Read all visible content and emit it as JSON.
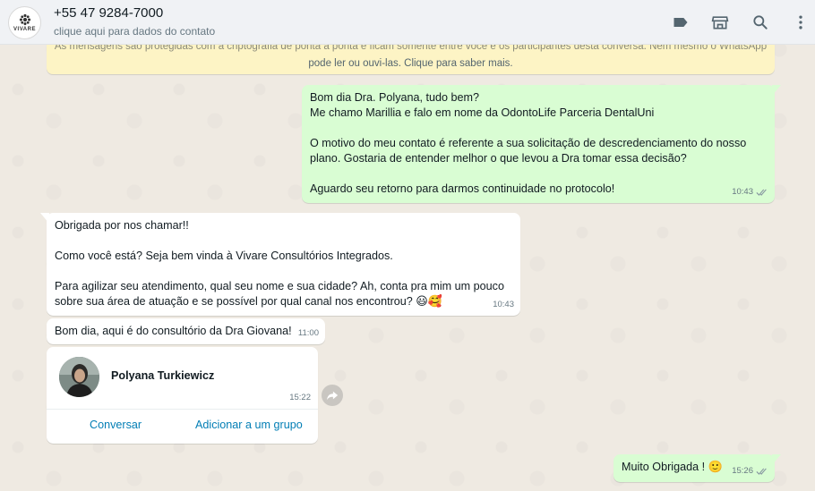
{
  "header": {
    "avatar_text": "VIVARE",
    "contact_name": "+55 47 9284-7000",
    "contact_subtitle": "clique aqui para dados do contato",
    "icons": [
      "label-icon",
      "store-icon",
      "search-icon",
      "menu-icon"
    ]
  },
  "encryption_banner": {
    "line1": "As mensagens são protegidas com a criptografia de ponta a ponta e ficam somente entre você e os participantes desta conversa. Nem mesmo o WhatsApp",
    "line2": "pode ler ou ouvi-las. Clique para saber mais."
  },
  "messages": [
    {
      "direction": "out",
      "text": "Bom dia Dra. Polyana, tudo bem?\nMe chamo Marillia e falo em nome da OdontoLife Parceria DentalUni\n\nO motivo do meu contato é referente a sua solicitação de descredenciamento do nosso plano. Gostaria de entender melhor o que levou a Dra tomar essa decisão?\n\nAguardo seu retorno para darmos continuidade no protocolo!",
      "time": "10:43"
    },
    {
      "direction": "in",
      "text": "Obrigada por nos chamar!!\n\nComo você está? Seja bem vinda à  Vivare Consultórios Integrados.\n\nPara agilizar seu atendimento, qual seu nome  e sua cidade? Ah, conta pra mim um pouco sobre sua área de atuação e se possível por qual canal nos encontrou? ",
      "emoji": "😃🥰",
      "time": "10:43"
    },
    {
      "direction": "in",
      "text": "Bom dia, aqui é do consultório da Dra Giovana!",
      "time": "11:00"
    },
    {
      "direction": "out",
      "text": "Muito Obrigada ! ",
      "emoji": "🙂",
      "time": "15:26"
    }
  ],
  "contact_card": {
    "name": "Polyana Turkiewicz",
    "time": "15:22",
    "button_message": "Conversar",
    "button_add_group": "Adicionar a um grupo"
  },
  "colors": {
    "outgoing_bubble": "#d9fdd3",
    "incoming_bubble": "#ffffff",
    "header_bg": "#f0f2f5",
    "link_blue": "#027eb5",
    "chat_bg": "#efeae2",
    "banner_bg": "#fdf4c5"
  }
}
